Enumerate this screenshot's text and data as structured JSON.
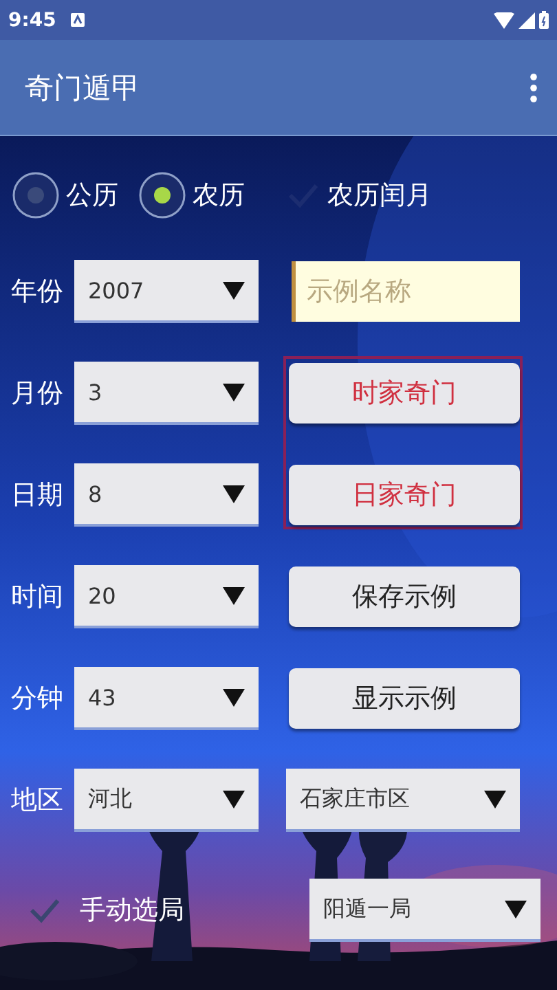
{
  "status_bar": {
    "time": "9:45"
  },
  "app_bar": {
    "title": "奇门遁甲"
  },
  "calendar_options": [
    {
      "kind": "radio",
      "label": "公历",
      "selected": false
    },
    {
      "kind": "radio",
      "label": "农历",
      "selected": true
    },
    {
      "kind": "checkbox",
      "label": "农历闰月",
      "checked": false
    }
  ],
  "form_rows": [
    {
      "label": "年份",
      "value": "2007",
      "right": {
        "kind": "field",
        "placeholder": "示例名称"
      }
    },
    {
      "label": "月份",
      "value": "3",
      "right": {
        "kind": "button",
        "label": "时家奇门",
        "highlighted": true
      }
    },
    {
      "label": "日期",
      "value": "8",
      "right": {
        "kind": "button",
        "label": "日家奇门",
        "highlighted": true
      }
    },
    {
      "label": "时间",
      "value": "20",
      "right": {
        "kind": "button",
        "label": "保存示例",
        "highlighted": false
      }
    },
    {
      "label": "分钟",
      "value": "43",
      "right": {
        "kind": "button",
        "label": "显示示例",
        "highlighted": false
      }
    },
    {
      "label": "地区",
      "value": "河北",
      "right": {
        "kind": "select",
        "value": "石家庄市区"
      }
    }
  ],
  "manual": {
    "label": "手动选局",
    "checked": false,
    "value": "阳遁一局"
  }
}
